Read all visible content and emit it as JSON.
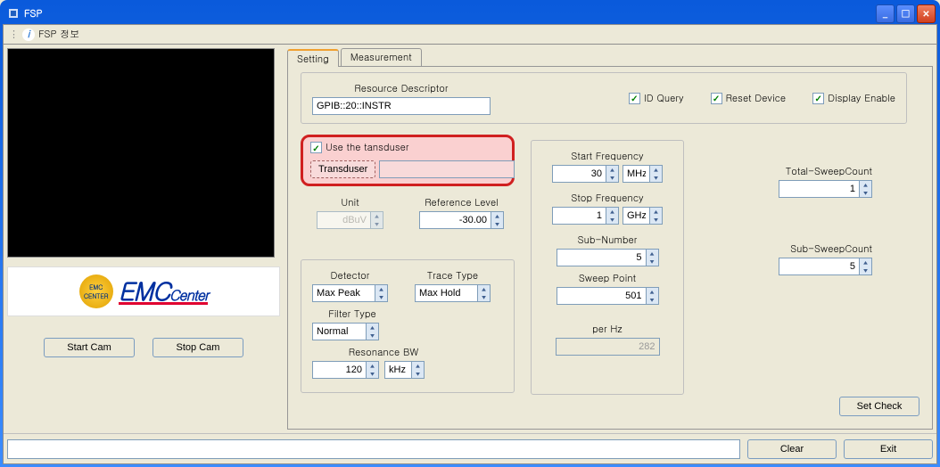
{
  "window": {
    "title": "FSP"
  },
  "menubar": {
    "info": "FSP 정보"
  },
  "logo": {
    "main": "EMC",
    "sub": "Center",
    "badge": "EMC CENTER"
  },
  "cam": {
    "start": "Start Cam",
    "stop": "Stop Cam"
  },
  "tabs": {
    "setting": "Setting",
    "measurement": "Measurement"
  },
  "resource": {
    "label": "Resource Descriptor",
    "value": "GPIB::20::INSTR",
    "id_query": "ID Query",
    "reset": "Reset Device",
    "display_enable": "Display Enable"
  },
  "transducer": {
    "use_label": "Use the tansduser",
    "button": "Transduser",
    "value": ""
  },
  "unit": {
    "label": "Unit",
    "value": "dBuV"
  },
  "ref": {
    "label": "Reference Level",
    "value": "-30.00"
  },
  "detector": {
    "label": "Detector",
    "value": "Max Peak"
  },
  "trace": {
    "label": "Trace Type",
    "value": "Max Hold"
  },
  "filter": {
    "label": "Filter Type",
    "value": "Normal"
  },
  "rbw": {
    "label": "Resonance BW",
    "value": "120",
    "unit": "kHz"
  },
  "freq": {
    "start_label": "Start Frequency",
    "start_value": "30",
    "start_unit": "MHz",
    "stop_label": "Stop Frequency",
    "stop_value": "1",
    "stop_unit": "GHz",
    "sub_label": "Sub-Number",
    "sub_value": "5",
    "sweep_label": "Sweep Point",
    "sweep_value": "501",
    "perhz_label": "per Hz",
    "perhz_value": "282"
  },
  "counts": {
    "total_label": "Total-SweepCount",
    "total_value": "1",
    "sub_label": "Sub-SweepCount",
    "sub_value": "5"
  },
  "buttons": {
    "set_check": "Set Check",
    "clear": "Clear",
    "exit": "Exit"
  }
}
